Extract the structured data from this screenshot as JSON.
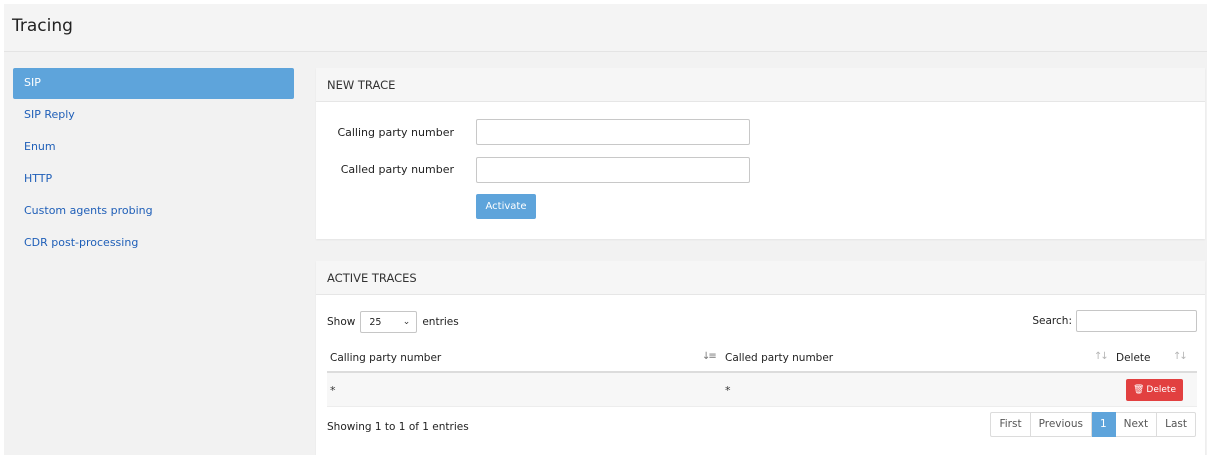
{
  "page": {
    "title": "Tracing"
  },
  "sidebar": {
    "items": [
      {
        "label": "SIP",
        "active": true
      },
      {
        "label": "SIP Reply"
      },
      {
        "label": "Enum"
      },
      {
        "label": "HTTP"
      },
      {
        "label": "Custom agents probing"
      },
      {
        "label": "CDR post-processing"
      }
    ]
  },
  "new_trace": {
    "title": "NEW TRACE",
    "calling_label": "Calling party number",
    "calling_value": "",
    "called_label": "Called party number",
    "called_value": "",
    "activate_label": "Activate"
  },
  "active_traces": {
    "title": "ACTIVE TRACES",
    "show_label": "Show",
    "page_size": "25",
    "entries_label": "entries",
    "search_label": "Search:",
    "search_value": "",
    "columns": [
      "Calling party number",
      "Called party number",
      "Delete"
    ],
    "rows": [
      {
        "calling": "*",
        "called": "*",
        "delete_label": "Delete"
      }
    ],
    "info": "Showing 1 to 1 of 1 entries",
    "pagination": {
      "first": "First",
      "previous": "Previous",
      "current": "1",
      "next": "Next",
      "last": "Last"
    }
  },
  "colors": {
    "accent": "#5ea4db",
    "danger": "#e24040",
    "link": "#1f5fb8"
  },
  "icons": {
    "sort": "sort-icon",
    "sort_active": "sort-asc-icon",
    "delete": "trash-icon",
    "select": "chevron-down-icon"
  }
}
